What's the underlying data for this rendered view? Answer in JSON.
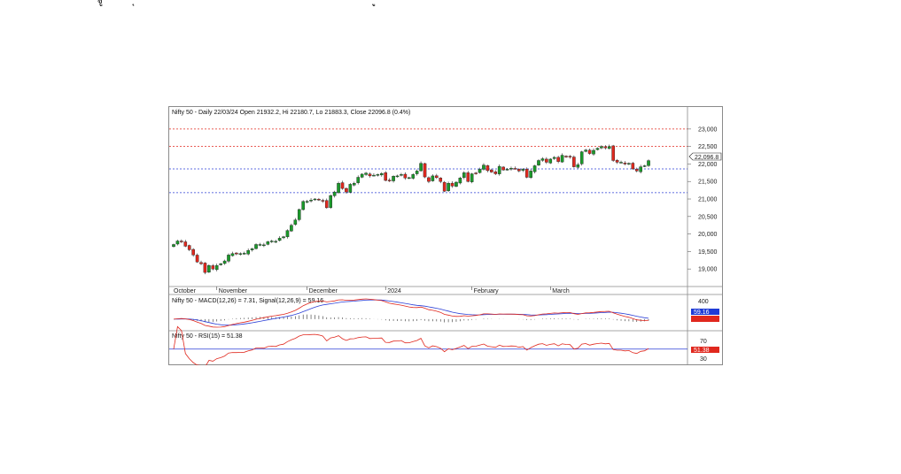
{
  "chart_data": {
    "type": "candlestick",
    "title": "Nifty 50 - Daily 22/03/24 Open 21932.2, Hi 22180.7, Lo 21883.3, Close 22096.8 (0.4%)",
    "ylim": [
      18600,
      23300
    ],
    "y_ticks": [
      "23,000",
      "22,500",
      "22,000",
      "21,500",
      "21,000",
      "20,500",
      "20,000",
      "19,500",
      "19,000"
    ],
    "last_price_label": "22,096.8",
    "months": [
      {
        "label": "October",
        "index": 0
      },
      {
        "label": "November",
        "index": 11
      },
      {
        "label": "December",
        "index": 34
      },
      {
        "label": "2024",
        "index": 54
      },
      {
        "label": "February",
        "index": 76
      },
      {
        "label": "March",
        "index": 96
      }
    ],
    "reference_lines": [
      {
        "value": 23000,
        "color": "#e0281e",
        "style": "dotted"
      },
      {
        "value": 22500,
        "color": "#e0281e",
        "style": "dotted"
      },
      {
        "value": 21860,
        "color": "#2b3fd6",
        "style": "dotted"
      },
      {
        "value": 21180,
        "color": "#2b3fd6",
        "style": "dotted"
      }
    ],
    "close": [
      19700,
      19800,
      19790,
      19650,
      19550,
      19400,
      19200,
      19150,
      18900,
      19100,
      19000,
      19100,
      19150,
      19230,
      19400,
      19440,
      19430,
      19440,
      19450,
      19530,
      19580,
      19700,
      19700,
      19690,
      19780,
      19800,
      19790,
      19880,
      19920,
      20100,
      20250,
      20400,
      20700,
      20930,
      20930,
      20970,
      21000,
      20980,
      20940,
      20750,
      21100,
      21200,
      21450,
      21300,
      21200,
      21420,
      21450,
      21620,
      21710,
      21740,
      21660,
      21680,
      21700,
      21730,
      21530,
      21520,
      21650,
      21660,
      21700,
      21600,
      21610,
      21700,
      21800,
      22020,
      21630,
      21500,
      21660,
      21610,
      21500,
      21220,
      21450,
      21370,
      21480,
      21600,
      21750,
      21500,
      21720,
      21740,
      21850,
      21970,
      21810,
      21770,
      21720,
      21930,
      21830,
      21850,
      21880,
      21870,
      21800,
      21850,
      21620,
      21800,
      21950,
      22100,
      22150,
      22050,
      22140,
      22190,
      22070,
      22250,
      22210,
      22200,
      21920,
      21980,
      22350,
      22400,
      22300,
      22390,
      22450,
      22500,
      22460,
      22500,
      22100,
      22050,
      22050,
      22000,
      22020,
      21860,
      21800,
      21920,
      21950,
      22096.8
    ],
    "macd_label": "Nifty 50 - MACD(12,26) = 7.31, Signal(12,26,9) = 59.16",
    "macd_ticks": [
      "400"
    ],
    "macd_value_label": "59.16",
    "rsi_label": "Nifty 50 - RSI(15) = 51.38",
    "rsi_ticks": [
      "70",
      "30"
    ],
    "rsi_value_label": "51.38",
    "colors": {
      "up": "#1a9a2a",
      "down": "#e0281e",
      "macd": "#e0281e",
      "signal": "#2b3fd6",
      "rsi": "#e0281e",
      "rsi_mid": "#2b3fd6"
    }
  },
  "top_glyphs": {
    "left": "ฐู",
    "mid": "ุ",
    "right": "ู"
  }
}
